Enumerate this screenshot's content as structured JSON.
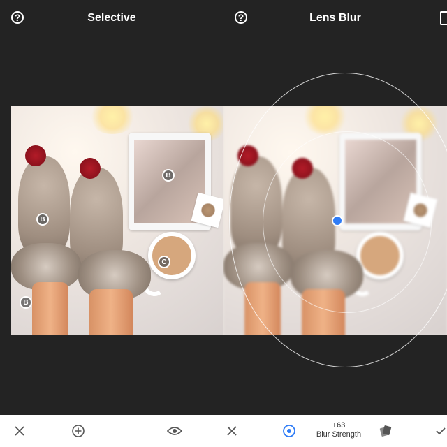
{
  "left_panel": {
    "title": "Selective",
    "help_glyph": "?",
    "pins": [
      {
        "label": "B",
        "role": "point-on-socks"
      },
      {
        "label": "B",
        "role": "point-on-tablet"
      },
      {
        "label": "C",
        "role": "point-on-coffee",
        "active": true
      },
      {
        "label": "B",
        "role": "point-on-blanket"
      }
    ]
  },
  "right_panel": {
    "title": "Lens Blur",
    "help_glyph": "?"
  },
  "bottom_toolbar": {
    "left": {
      "icons": [
        "close-icon",
        "add-icon",
        "eye-icon"
      ]
    },
    "right": {
      "icons": [
        "close-icon",
        "blur-shape-icon",
        "style-icon",
        "checkmark-icon"
      ],
      "blur_strength_value": "+63",
      "blur_strength_label": "Blur Strength"
    }
  },
  "colors": {
    "background": "#232323",
    "accent": "#2f7cf6",
    "toolbar": "#ffffff"
  }
}
